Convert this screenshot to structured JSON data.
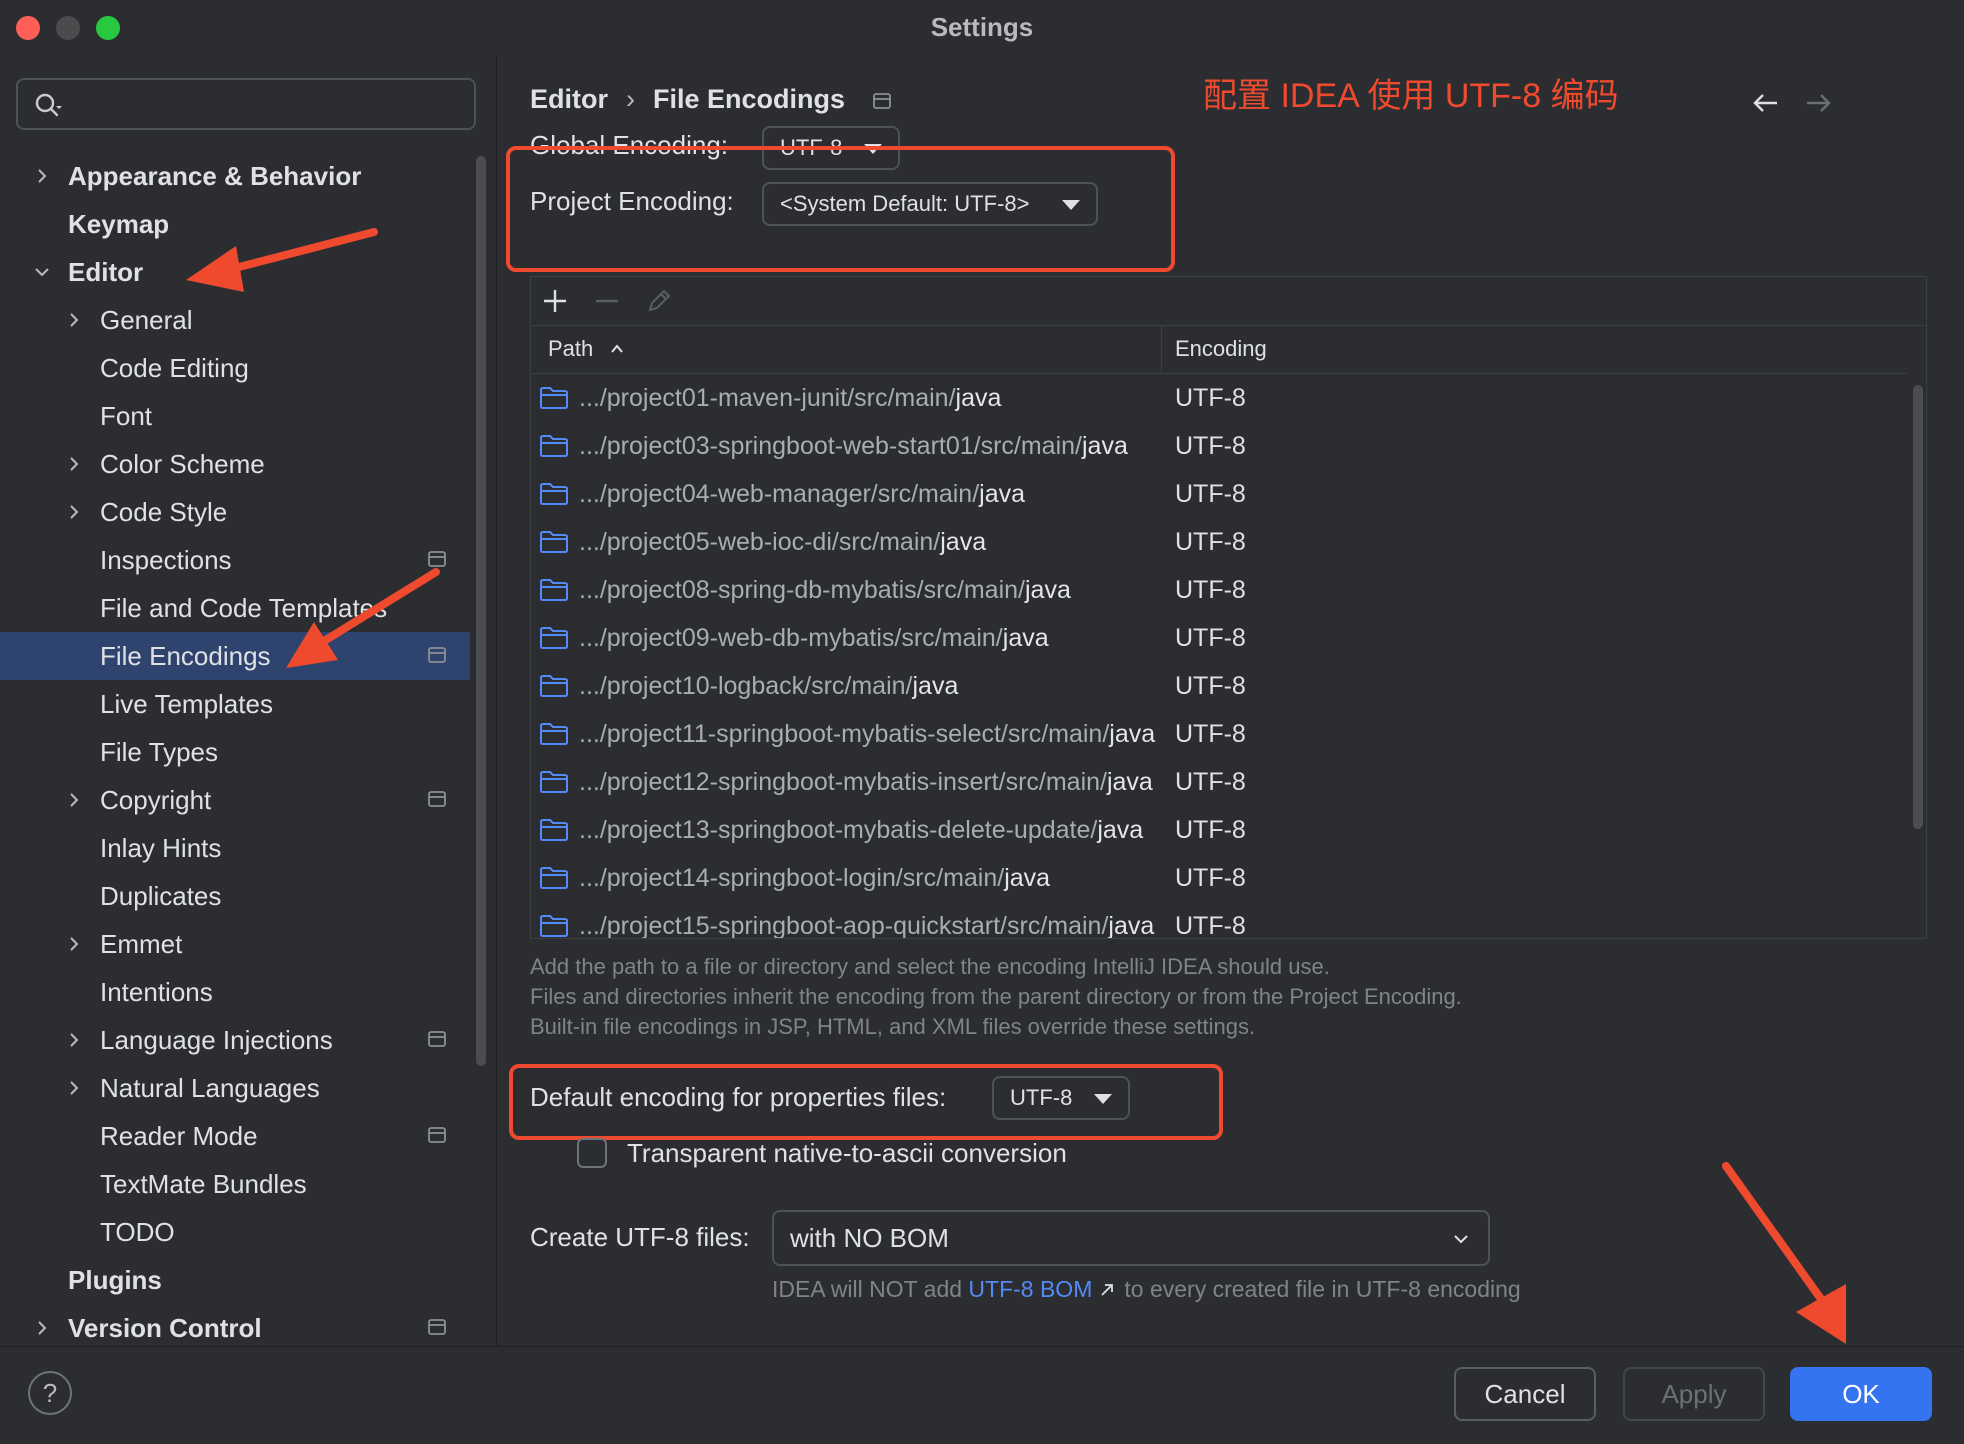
{
  "window": {
    "title": "Settings"
  },
  "search": {
    "placeholder": "",
    "value": ""
  },
  "sidebar": {
    "items": [
      {
        "label": "Appearance & Behavior",
        "level": 0,
        "chevron": "right",
        "bold": true,
        "project_icon": false,
        "selected": false
      },
      {
        "label": "Keymap",
        "level": 0,
        "chevron": "none",
        "bold": true,
        "project_icon": false,
        "selected": false
      },
      {
        "label": "Editor",
        "level": 0,
        "chevron": "down",
        "bold": true,
        "project_icon": false,
        "selected": false
      },
      {
        "label": "General",
        "level": 1,
        "chevron": "right",
        "bold": false,
        "project_icon": false,
        "selected": false
      },
      {
        "label": "Code Editing",
        "level": 1,
        "chevron": "none",
        "bold": false,
        "project_icon": false,
        "selected": false
      },
      {
        "label": "Font",
        "level": 1,
        "chevron": "none",
        "bold": false,
        "project_icon": false,
        "selected": false
      },
      {
        "label": "Color Scheme",
        "level": 1,
        "chevron": "right",
        "bold": false,
        "project_icon": false,
        "selected": false
      },
      {
        "label": "Code Style",
        "level": 1,
        "chevron": "right",
        "bold": false,
        "project_icon": false,
        "selected": false
      },
      {
        "label": "Inspections",
        "level": 1,
        "chevron": "none",
        "bold": false,
        "project_icon": true,
        "selected": false
      },
      {
        "label": "File and Code Templates",
        "level": 1,
        "chevron": "none",
        "bold": false,
        "project_icon": false,
        "selected": false
      },
      {
        "label": "File Encodings",
        "level": 1,
        "chevron": "none",
        "bold": false,
        "project_icon": true,
        "selected": true
      },
      {
        "label": "Live Templates",
        "level": 1,
        "chevron": "none",
        "bold": false,
        "project_icon": false,
        "selected": false
      },
      {
        "label": "File Types",
        "level": 1,
        "chevron": "none",
        "bold": false,
        "project_icon": false,
        "selected": false
      },
      {
        "label": "Copyright",
        "level": 1,
        "chevron": "right",
        "bold": false,
        "project_icon": true,
        "selected": false
      },
      {
        "label": "Inlay Hints",
        "level": 1,
        "chevron": "none",
        "bold": false,
        "project_icon": false,
        "selected": false
      },
      {
        "label": "Duplicates",
        "level": 1,
        "chevron": "none",
        "bold": false,
        "project_icon": false,
        "selected": false
      },
      {
        "label": "Emmet",
        "level": 1,
        "chevron": "right",
        "bold": false,
        "project_icon": false,
        "selected": false
      },
      {
        "label": "Intentions",
        "level": 1,
        "chevron": "none",
        "bold": false,
        "project_icon": false,
        "selected": false
      },
      {
        "label": "Language Injections",
        "level": 1,
        "chevron": "right",
        "bold": false,
        "project_icon": true,
        "selected": false
      },
      {
        "label": "Natural Languages",
        "level": 1,
        "chevron": "right",
        "bold": false,
        "project_icon": false,
        "selected": false
      },
      {
        "label": "Reader Mode",
        "level": 1,
        "chevron": "none",
        "bold": false,
        "project_icon": true,
        "selected": false
      },
      {
        "label": "TextMate Bundles",
        "level": 1,
        "chevron": "none",
        "bold": false,
        "project_icon": false,
        "selected": false
      },
      {
        "label": "TODO",
        "level": 1,
        "chevron": "none",
        "bold": false,
        "project_icon": false,
        "selected": false
      },
      {
        "label": "Plugins",
        "level": 0,
        "chevron": "none",
        "bold": true,
        "project_icon": false,
        "selected": false
      },
      {
        "label": "Version Control",
        "level": 0,
        "chevron": "right",
        "bold": true,
        "project_icon": true,
        "selected": false
      }
    ]
  },
  "header": {
    "breadcrumb_parent": "Editor",
    "breadcrumb_sep": "›",
    "breadcrumb_current": "File Encodings",
    "annotation_note": "配置 IDEA 使用 UTF-8 编码"
  },
  "encoding": {
    "global_label": "Global Encoding:",
    "global_value": "UTF-8",
    "project_label": "Project Encoding:",
    "project_value": "<System Default: UTF-8>"
  },
  "table": {
    "col_path": "Path",
    "col_encoding": "Encoding",
    "rows": [
      {
        "path_dim": ".../project01-maven-junit/src/main/",
        "path_bright": "java",
        "encoding": "UTF-8"
      },
      {
        "path_dim": ".../project03-springboot-web-start01/src/main/",
        "path_bright": "java",
        "encoding": "UTF-8"
      },
      {
        "path_dim": ".../project04-web-manager/src/main/",
        "path_bright": "java",
        "encoding": "UTF-8"
      },
      {
        "path_dim": ".../project05-web-ioc-di/src/main/",
        "path_bright": "java",
        "encoding": "UTF-8"
      },
      {
        "path_dim": ".../project08-spring-db-mybatis/src/main/",
        "path_bright": "java",
        "encoding": "UTF-8"
      },
      {
        "path_dim": ".../project09-web-db-mybatis/src/main/",
        "path_bright": "java",
        "encoding": "UTF-8"
      },
      {
        "path_dim": ".../project10-logback/src/main/",
        "path_bright": "java",
        "encoding": "UTF-8"
      },
      {
        "path_dim": ".../project11-springboot-mybatis-select/src/main/",
        "path_bright": "java",
        "encoding": "UTF-8"
      },
      {
        "path_dim": ".../project12-springboot-mybatis-insert/src/main/",
        "path_bright": "java",
        "encoding": "UTF-8"
      },
      {
        "path_dim": ".../project13-springboot-mybatis-delete-update/",
        "path_bright": "java",
        "encoding": "UTF-8"
      },
      {
        "path_dim": ".../project14-springboot-login/src/main/",
        "path_bright": "java",
        "encoding": "UTF-8"
      },
      {
        "path_dim": ".../project15-springboot-aop-quickstart/src/main/",
        "path_bright": "java",
        "encoding": "UTF-8"
      }
    ]
  },
  "hints": {
    "line1": "Add the path to a file or directory and select the encoding IntelliJ IDEA should use.",
    "line2": "Files and directories inherit the encoding from the parent directory or from the Project Encoding.",
    "line3": "Built-in file encodings in JSP, HTML, and XML files override these settings."
  },
  "properties": {
    "label": "Default encoding for properties files:",
    "value": "UTF-8",
    "native_label": "Transparent native-to-ascii conversion",
    "native_checked": false
  },
  "bom": {
    "label": "Create UTF-8 files:",
    "value": "with NO BOM",
    "hint_prefix": "IDEA will NOT add",
    "hint_link": "UTF-8 BOM",
    "hint_suffix": "to every created file in UTF-8 encoding"
  },
  "footer": {
    "help": "?",
    "cancel": "Cancel",
    "apply": "Apply",
    "ok": "OK"
  },
  "colors": {
    "annotation_red": "#f04a2e",
    "accent_blue": "#3574f0",
    "selection": "#2e436e",
    "link": "#548af7"
  }
}
